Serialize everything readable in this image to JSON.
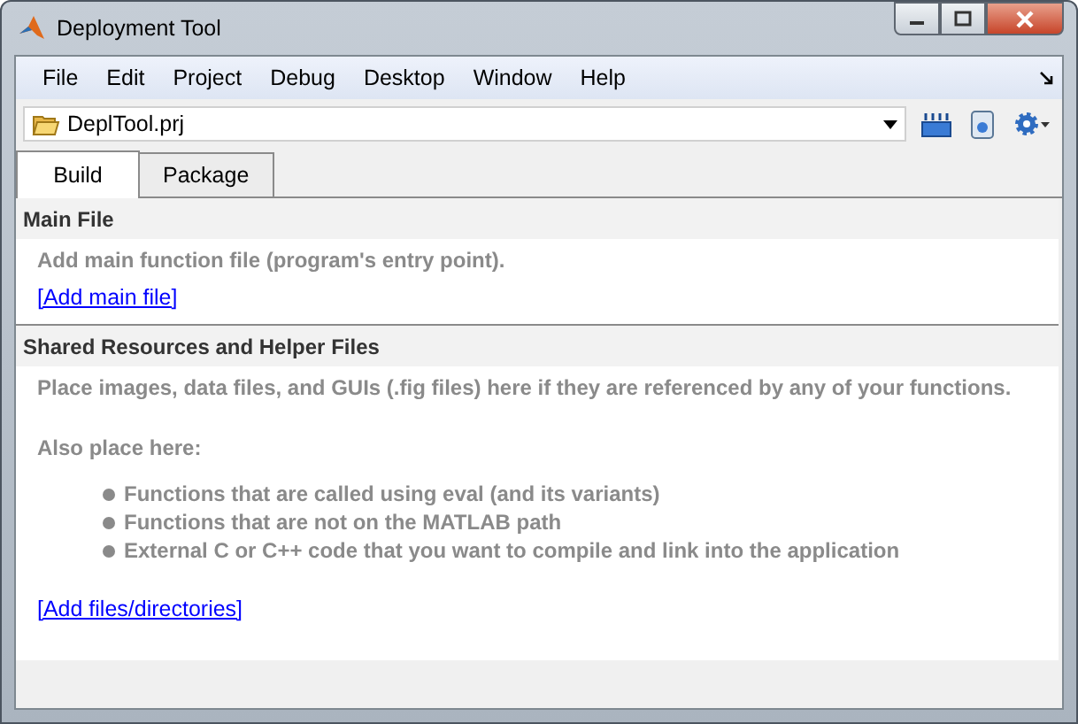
{
  "window": {
    "title": "Deployment Tool"
  },
  "menu": [
    "File",
    "Edit",
    "Project",
    "Debug",
    "Desktop",
    "Window",
    "Help"
  ],
  "project": {
    "value": "DeplTool.prj"
  },
  "tabs": [
    {
      "label": "Build",
      "selected": true
    },
    {
      "label": "Package",
      "selected": false
    }
  ],
  "sections": [
    {
      "title": "Main File",
      "description": "Add main function file (program's entry point).",
      "link": "[Add main file]"
    },
    {
      "title": "Shared Resources and Helper Files",
      "description": "Place images, data files, and GUIs (.fig files) here if they are referenced by any of your functions.",
      "note": "Also place here:",
      "bullets": [
        "Functions that are called using eval (and its variants)",
        "Functions that are not on the MATLAB path",
        "External C or C++ code that you want to compile and link into the application"
      ],
      "link": "[Add files/directories]"
    }
  ]
}
